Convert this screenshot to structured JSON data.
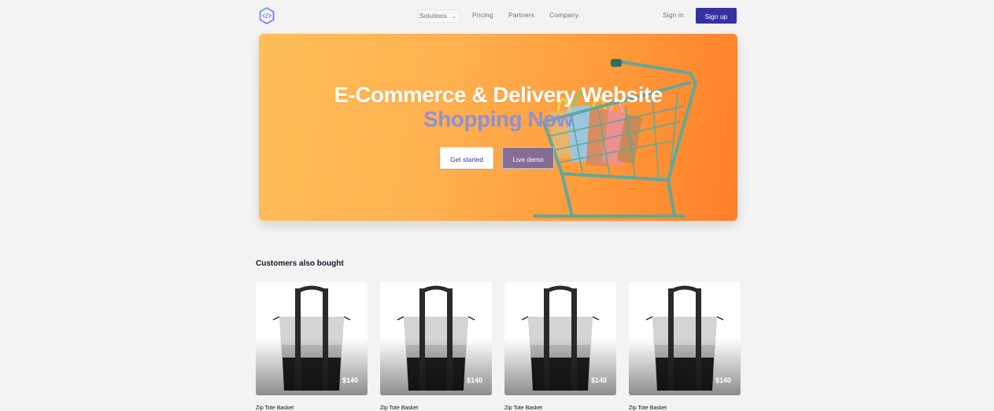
{
  "nav": {
    "logo_icon": "code-hexagon-icon",
    "solutions_label": "Solutions",
    "pricing_label": "Pricing",
    "partners_label": "Partners",
    "company_label": "Company",
    "signin_label": "Sign in",
    "signup_label": "Sign up"
  },
  "hero": {
    "title": "E-Commerce & Delivery Website",
    "subtitle": "Shopping Now",
    "get_started_label": "Get started",
    "live_demo_label": "Live demo"
  },
  "products": {
    "heading": "Customers also bought",
    "items": [
      {
        "name": "Zip Tote Basket",
        "price": "$140"
      },
      {
        "name": "Zip Tote Basket",
        "price": "$140"
      },
      {
        "name": "Zip Tote Basket",
        "price": "$140"
      },
      {
        "name": "Zip Tote Basket",
        "price": "$140"
      }
    ]
  },
  "colors": {
    "accent": "#3730a3",
    "hero_orange": "#ffb04f",
    "subtitle": "#8f8fd6"
  }
}
